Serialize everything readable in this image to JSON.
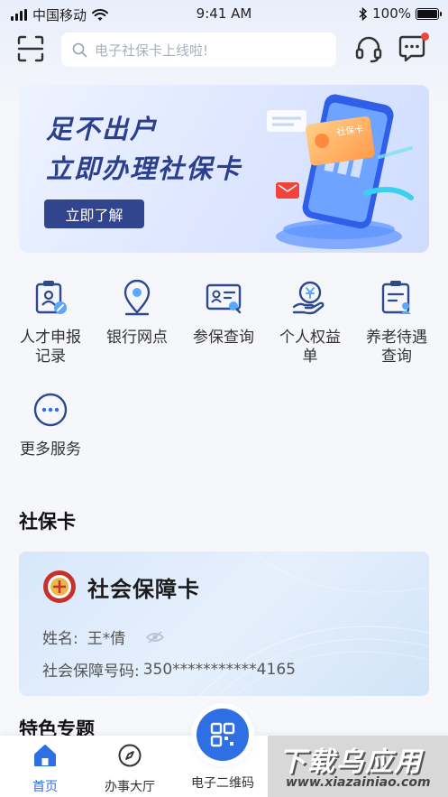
{
  "status_bar": {
    "carrier": "中国移动",
    "time": "9:41 AM",
    "battery": "100%"
  },
  "header": {
    "search_placeholder": "电子社保卡上线啦!",
    "icons": [
      "scan-icon",
      "search-icon",
      "headset-icon",
      "message-icon"
    ]
  },
  "banner": {
    "line1": "足不出户",
    "line2": "立即办理社保卡",
    "cta": "立即了解",
    "card_label": "社保卡"
  },
  "services": [
    {
      "label": "人才申报\n记录",
      "icon": "talent-record-icon"
    },
    {
      "label": "银行网点",
      "icon": "location-icon"
    },
    {
      "label": "参保查询",
      "icon": "insurance-query-icon"
    },
    {
      "label": "个人权益\n单",
      "icon": "personal-rights-icon"
    },
    {
      "label": "养老待遇\n查询",
      "icon": "pension-query-icon"
    },
    {
      "label": "更多服务",
      "icon": "more-icon"
    }
  ],
  "social_card_section": {
    "title": "社保卡",
    "card_title": "社会保障卡",
    "name_label": "姓名:",
    "name_value": "王*倩",
    "number_label": "社会保障号码:",
    "number_value": "350***********4165"
  },
  "featured": {
    "title": "特色专题"
  },
  "tabbar": {
    "tabs": [
      {
        "label": "首页",
        "active": true
      },
      {
        "label": "办事大厅",
        "active": false
      },
      {
        "label": "电子二维码",
        "active": false
      }
    ]
  },
  "watermark": {
    "line1": "下载乌应用",
    "line2": "www.xiazainiao.com"
  },
  "colors": {
    "primary": "#2f6fe4",
    "banner_text": "#2b3f8e",
    "badge_red": "#f0443a"
  }
}
